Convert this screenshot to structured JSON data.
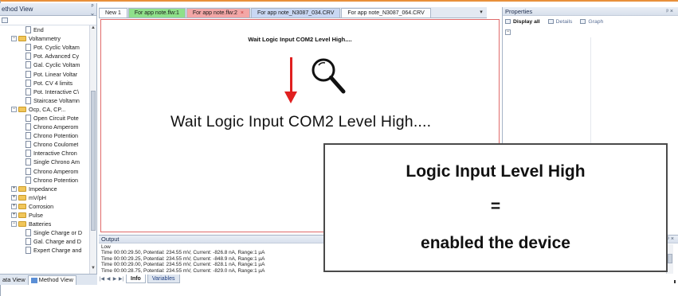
{
  "left_panel": {
    "title": "ethod View",
    "pin": "ᵖ ⌄",
    "tree": [
      {
        "label": "End",
        "type": "doc",
        "indent": 2
      },
      {
        "label": "Voltammetry",
        "type": "folder",
        "indent": 1,
        "expander": "−"
      },
      {
        "label": "Pot. Cyclic Voltam",
        "type": "doc",
        "indent": 2
      },
      {
        "label": "Pot. Advanced Cy",
        "type": "doc",
        "indent": 2
      },
      {
        "label": "Gal. Cyclic Voltam",
        "type": "doc",
        "indent": 2
      },
      {
        "label": "Pot. Linear Voltar",
        "type": "doc",
        "indent": 2
      },
      {
        "label": "Pot. CV 4 limits",
        "type": "doc",
        "indent": 2
      },
      {
        "label": "Pot. Interactive C\\",
        "type": "doc",
        "indent": 2
      },
      {
        "label": "Staircase Voltamn",
        "type": "doc",
        "indent": 2
      },
      {
        "label": "Ocp, CA, CP...",
        "type": "folder",
        "indent": 1,
        "expander": "−"
      },
      {
        "label": "Open Circuit Pote",
        "type": "doc",
        "indent": 2
      },
      {
        "label": "Chrono Amperom",
        "type": "doc",
        "indent": 2
      },
      {
        "label": "Chrono Potention",
        "type": "doc",
        "indent": 2
      },
      {
        "label": "Chrono Coulomet",
        "type": "doc",
        "indent": 2
      },
      {
        "label": "Interactive Chron",
        "type": "doc",
        "indent": 2
      },
      {
        "label": "Single Chrono Am",
        "type": "doc",
        "indent": 2
      },
      {
        "label": "Chrono Amperom",
        "type": "doc",
        "indent": 2
      },
      {
        "label": "Chrono Potention",
        "type": "doc",
        "indent": 2
      },
      {
        "label": "Impedance",
        "type": "folder",
        "indent": 1,
        "expander": "+"
      },
      {
        "label": "mV/pH",
        "type": "folder",
        "indent": 1,
        "expander": "+"
      },
      {
        "label": "Corrosion",
        "type": "folder",
        "indent": 1,
        "expander": "+"
      },
      {
        "label": "Pulse",
        "type": "folder",
        "indent": 1,
        "expander": "+"
      },
      {
        "label": "Batteries",
        "type": "folder",
        "indent": 1,
        "expander": "−"
      },
      {
        "label": "Single Charge or D",
        "type": "doc",
        "indent": 2
      },
      {
        "label": "Gal. Charge and D",
        "type": "doc",
        "indent": 2
      },
      {
        "label": "Expert Charge and",
        "type": "doc",
        "indent": 2
      }
    ],
    "tabs": {
      "data_view": "ata View",
      "method_view": "Method View"
    }
  },
  "doc_tabs": [
    {
      "label": "New 1",
      "style": "t-white"
    },
    {
      "label": "For app note.flw:1",
      "style": "t-green"
    },
    {
      "label": "For app note.flw:2",
      "style": "t-red",
      "close": "×"
    },
    {
      "label": "For app note_N3087_034.CRV",
      "style": "t-blue"
    },
    {
      "label": "For app note_N3087_064.CRV",
      "style": "t-white"
    }
  ],
  "doc_dropdown": "▾",
  "doc_message": "Wait Logic Input COM2 Level High....",
  "output": {
    "title": "Output",
    "controls": "ᵖ ×",
    "lines": [
      "Low",
      "Time 00:00:29.50, Potential: 234.55 mV, Current: -826.8 nA, Range:1 µA",
      "Time 00:00:29.25, Potential: 234.55 mV, Current: -848.9 nA, Range:1 µA",
      "Time 00:00:29.00, Potential: 234.55 mV, Current: -828.1 nA, Range:1 µA",
      "Time 00:00:28.75, Potential: 234.55 mV, Current: -829.0 nA, Range:1 µA"
    ]
  },
  "bottom_tabs": {
    "info": "Info",
    "variables": "Variables"
  },
  "properties": {
    "title": "Properties",
    "controls": "ᵖ ×",
    "toolbar": {
      "display_all": "Display all",
      "details": "Details",
      "graph": "Graph"
    },
    "collapse": "−"
  },
  "annotation": {
    "big_message": "Wait Logic Input COM2 Level High....",
    "callout_line1": "Logic Input Level High",
    "callout_line2": "=",
    "callout_line3": "enabled the device",
    "arrow_color": "#e02020"
  }
}
